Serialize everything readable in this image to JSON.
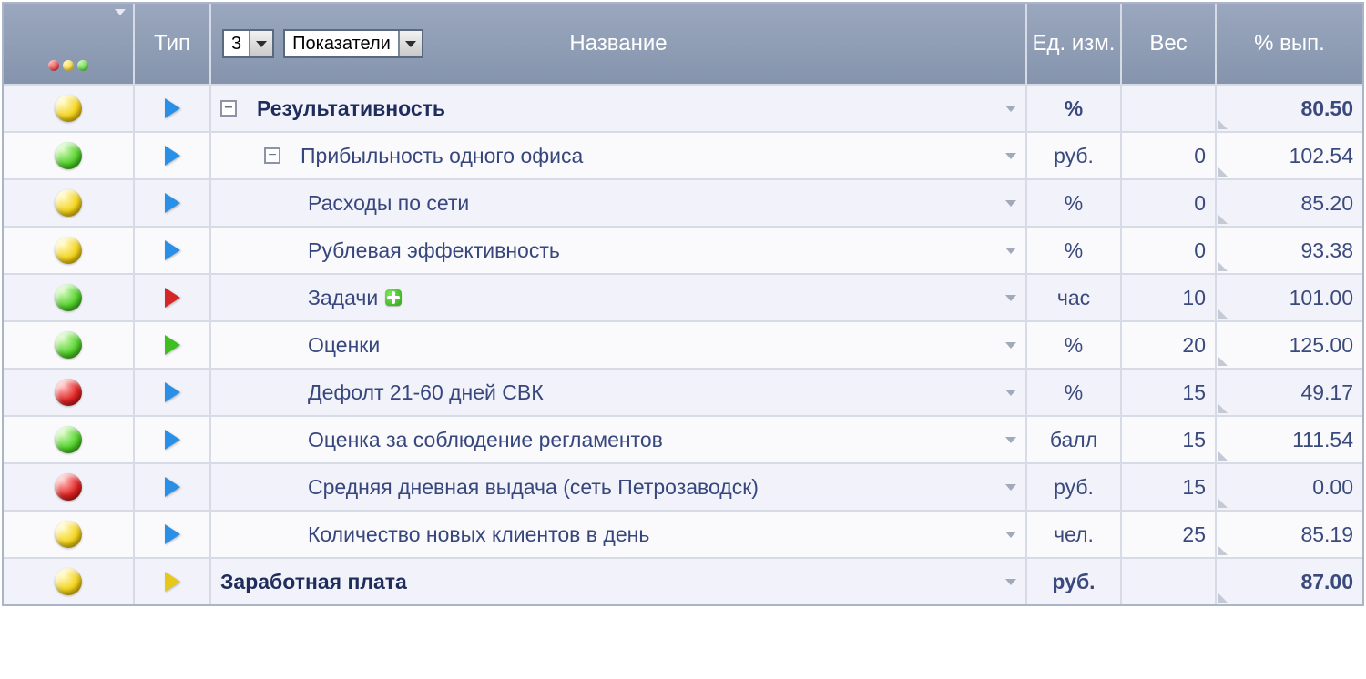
{
  "header": {
    "status_label": "",
    "type_label": "Тип",
    "name_title": "Название",
    "level_select": "3",
    "set_select": "Показатели",
    "unit_label": "Ед. изм.",
    "weight_label": "Вес",
    "pct_label": "% вып."
  },
  "rows": [
    {
      "status": "yellow",
      "type": "blue",
      "indent": 0,
      "bold": true,
      "expand": "-",
      "name": "Результативность",
      "plus": false,
      "unit": "%",
      "weight": "",
      "pct": "80.50"
    },
    {
      "status": "green",
      "type": "blue",
      "indent": 1,
      "bold": false,
      "expand": "-",
      "name": "Прибыльность одного офиса",
      "plus": false,
      "unit": "руб.",
      "weight": "0",
      "pct": "102.54"
    },
    {
      "status": "yellow",
      "type": "blue",
      "indent": 2,
      "bold": false,
      "expand": "",
      "name": "Расходы по сети",
      "plus": false,
      "unit": "%",
      "weight": "0",
      "pct": "85.20"
    },
    {
      "status": "yellow",
      "type": "blue",
      "indent": 2,
      "bold": false,
      "expand": "",
      "name": "Рублевая эффективность",
      "plus": false,
      "unit": "%",
      "weight": "0",
      "pct": "93.38"
    },
    {
      "status": "green",
      "type": "red",
      "indent": 2,
      "bold": false,
      "expand": "",
      "name": "Задачи",
      "plus": true,
      "unit": "час",
      "weight": "10",
      "pct": "101.00"
    },
    {
      "status": "green",
      "type": "green",
      "indent": 2,
      "bold": false,
      "expand": "",
      "name": "Оценки",
      "plus": false,
      "unit": "%",
      "weight": "20",
      "pct": "125.00"
    },
    {
      "status": "red",
      "type": "blue",
      "indent": 2,
      "bold": false,
      "expand": "",
      "name": "Дефолт 21-60 дней СВК",
      "plus": false,
      "unit": "%",
      "weight": "15",
      "pct": "49.17"
    },
    {
      "status": "green",
      "type": "blue",
      "indent": 2,
      "bold": false,
      "expand": "",
      "name": "Оценка за соблюдение регламентов",
      "plus": false,
      "unit": "балл",
      "weight": "15",
      "pct": "111.54"
    },
    {
      "status": "red",
      "type": "blue",
      "indent": 2,
      "bold": false,
      "expand": "",
      "name": "Средняя дневная выдача (сеть Петрозаводск)",
      "plus": false,
      "unit": "руб.",
      "weight": "15",
      "pct": "0.00"
    },
    {
      "status": "yellow",
      "type": "blue",
      "indent": 2,
      "bold": false,
      "expand": "",
      "name": "Количество новых клиентов в день",
      "plus": false,
      "unit": "чел.",
      "weight": "25",
      "pct": "85.19"
    },
    {
      "status": "yellow",
      "type": "yellow",
      "indent": 0,
      "bold": true,
      "expand": "",
      "name": "Заработная плата",
      "plus": false,
      "unit": "руб.",
      "weight": "",
      "pct": "87.00"
    }
  ]
}
